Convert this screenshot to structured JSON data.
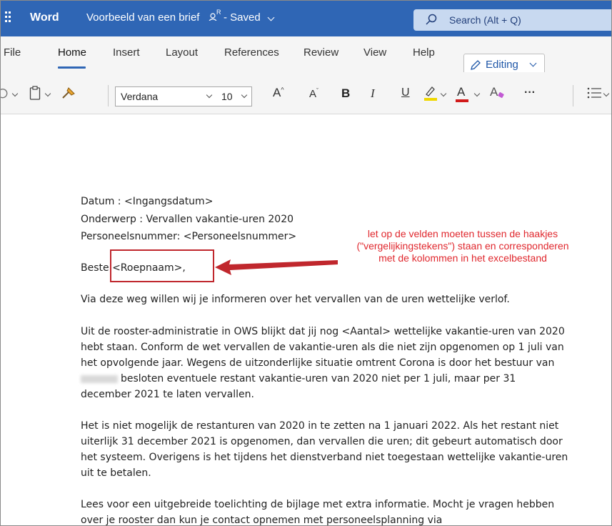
{
  "app": {
    "name": "Word",
    "doc_title": "Voorbeeld van een brief",
    "share_icon": "people-icon",
    "saved_status": "- Saved"
  },
  "search": {
    "label": "Search (Alt + Q)"
  },
  "ribbon": {
    "tabs": [
      {
        "label": "File"
      },
      {
        "label": "Home"
      },
      {
        "label": "Insert"
      },
      {
        "label": "Layout"
      },
      {
        "label": "References"
      },
      {
        "label": "Review"
      },
      {
        "label": "View"
      },
      {
        "label": "Help"
      }
    ],
    "active_tab": "Home",
    "editing_label": "Editing"
  },
  "toolbar": {
    "font_name": "Verdana",
    "font_size": "10",
    "grow_font": "A",
    "shrink_font": "A",
    "bold": "B",
    "italic": "I",
    "underline": "U",
    "font_color": "A",
    "clear_format": "A",
    "more": "···",
    "highlight_color": "#f0d800",
    "font_color_swatch": "#d11a1a"
  },
  "document": {
    "header_lines": [
      "Datum       : <Ingangsdatum>",
      "Onderwerp   : Vervallen vakantie-uren 2020",
      "Personeelsnummer: <Personeelsnummer>"
    ],
    "greeting": "Beste <Roepnaam>,",
    "para1": "Via deze weg willen wij je informeren over het vervallen van de uren wettelijke verlof.",
    "para2": [
      "Uit de rooster-administratie in OWS blijkt dat jij nog <Aantal> wettelijke vakantie-uren van 2020",
      "hebt staan. Conform de wet vervallen de vakantie-uren als die niet zijn opgenomen op 1 juli van",
      "het opvolgende jaar. Wegens de uitzonderlijke situatie omtrent Corona is door het bestuur van",
      "besloten eventuele restant vakantie-uren van 2020 niet per 1 juli, maar per 31",
      "december 2021 te laten vervallen."
    ],
    "para3": [
      "Het is niet mogelijk de restanturen van 2020 in te zetten na 1 januari 2022. Als het restant niet",
      "uiterlijk 31 december 2021 is opgenomen, dan vervallen die uren; dit gebeurt automatisch door",
      "het systeem. Overigens is het tijdens het dienstverband niet toegestaan wettelijke vakantie-uren",
      "uit te betalen."
    ],
    "para4": [
      "Lees voor een uitgebreide toelichting de bijlage met extra informatie. Mocht je vragen hebben",
      "over je rooster dan kun je contact opnemen met personeelsplanning via"
    ]
  },
  "annotation": {
    "lines": [
      "let op de velden moeten tussen de haakjes",
      "(\"vergelijkingstekens\") staan en corresponderen",
      "met de kolommen in het excelbestand"
    ],
    "color": "#e0282e"
  },
  "colors": {
    "titlebar": "#2f66b5",
    "search_box": "#c8d9f0",
    "accent": "#2f66b5"
  }
}
